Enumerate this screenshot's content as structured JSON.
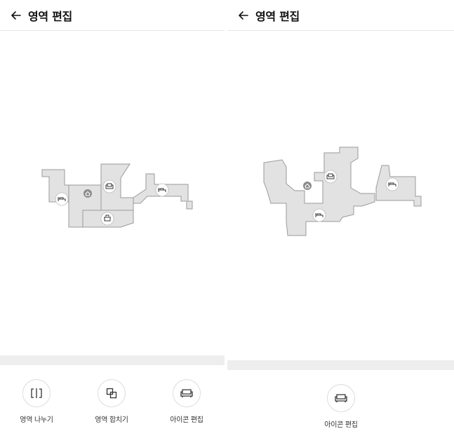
{
  "screens": [
    {
      "header": {
        "title": "영역 편집"
      },
      "toolbar": [
        {
          "label": "영역 나누기",
          "icon": "split-icon"
        },
        {
          "label": "영역 합치기",
          "icon": "merge-icon"
        },
        {
          "label": "아이콘 편집",
          "icon": "sofa-icon"
        }
      ]
    },
    {
      "header": {
        "title": "영역 편집"
      },
      "toolbar": [
        {
          "label": "아이콘 편집",
          "icon": "sofa-icon"
        }
      ]
    }
  ],
  "map": {
    "room_fill": "#e2e2e2",
    "room_stroke": "#9a9a9a",
    "home_marker_color": "#8c8c8c",
    "room_icons_left": [
      "bed-icon",
      "sofa-icon",
      "bed-icon",
      "pot-icon"
    ],
    "room_icons_right": [
      "sofa-icon",
      "bed-icon",
      "bed-icon"
    ]
  },
  "colors": {
    "band": "#eeeeee",
    "divider": "#e6e6e6"
  }
}
